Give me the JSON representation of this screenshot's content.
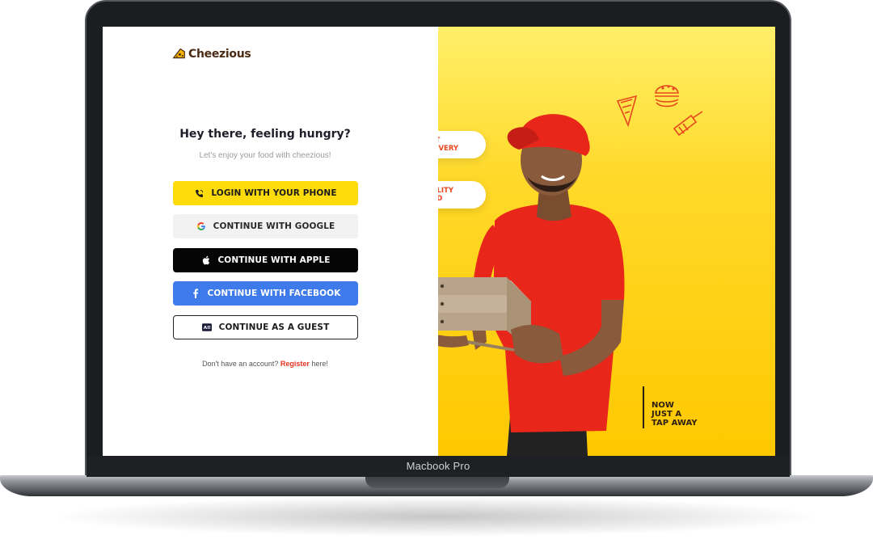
{
  "brand": {
    "name": "Cheezious"
  },
  "login": {
    "title": "Hey there, feeling hungry?",
    "subtitle": "Let's enjoy your food with cheezious!",
    "buttons": {
      "phone": "LOGIN WITH YOUR PHONE",
      "google": "CONTINUE WITH GOOGLE",
      "apple": "CONTINUE WITH APPLE",
      "facebook": "CONTINUE WITH FACEBOOK",
      "guest": "CONTINUE AS A GUEST"
    },
    "register_prefix": "Don't have an account?",
    "register_link": "Register",
    "register_suffix": "here!"
  },
  "hero": {
    "badges": {
      "delivery": "FAST DELIVERY",
      "quality": "QUALITY FOOD"
    },
    "tagline": [
      "NOW",
      "JUST A",
      "TAP AWAY"
    ]
  },
  "device": {
    "label": "Macbook Pro"
  },
  "colors": {
    "primary_yellow": "#fedb0a",
    "accent_red": "#e6321e",
    "facebook_blue": "#3e7ae9",
    "brand_brown": "#4a2a12"
  },
  "icons": [
    "phone-icon",
    "google-icon",
    "apple-icon",
    "facebook-icon",
    "guest-id-icon",
    "delivery-scooter-icon",
    "pizza-icon",
    "taco-doodle-icon",
    "burger-doodle-icon",
    "drink-doodle-icon"
  ]
}
